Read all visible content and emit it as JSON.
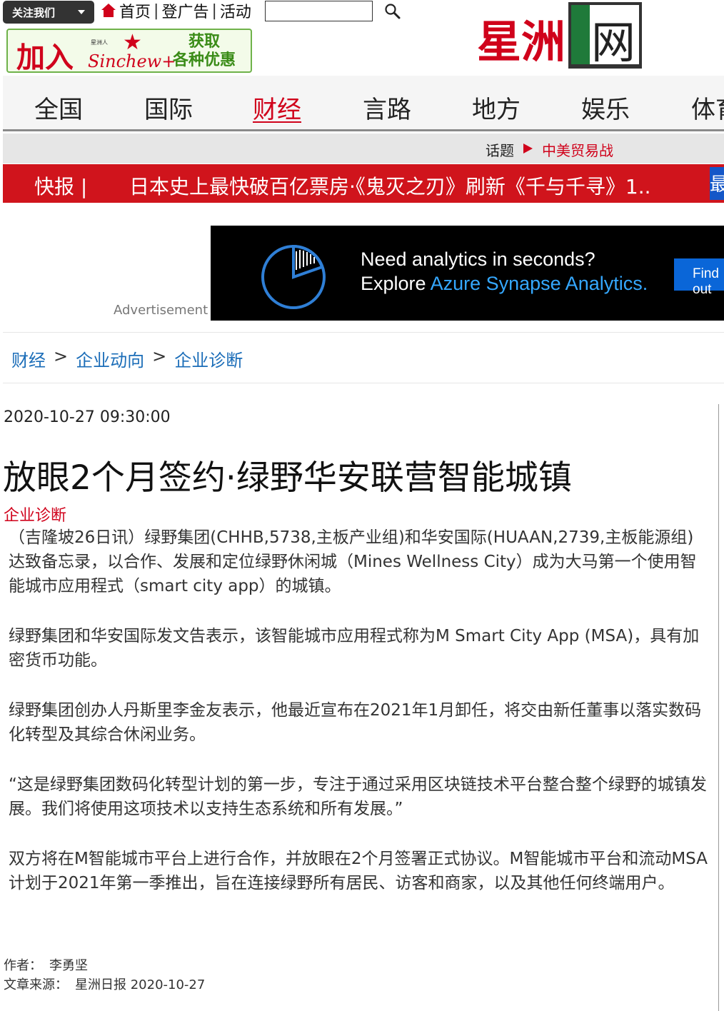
{
  "topbar": {
    "follow_label": "关注我们",
    "links": [
      "首页",
      "登广告",
      "活动"
    ],
    "separator": "|",
    "search_placeholder": ""
  },
  "join_banner": {
    "main": "加入",
    "sub": "星洲人",
    "brand": "Sinchew+",
    "offer_line1": "获取",
    "offer_line2": "各种优惠"
  },
  "logo": {
    "text": "星洲",
    "box_char": "网"
  },
  "nav": {
    "items": [
      "全国",
      "国际",
      "财经",
      "言路",
      "地方",
      "娱乐",
      "体育"
    ],
    "active": "财经"
  },
  "topic": {
    "label": "话题",
    "link": "中美贸易战"
  },
  "breaking": {
    "label": "快报 |",
    "headline": "日本史上最快破百亿票房·《鬼灭之刃》刷新《千与千寻》1...",
    "more": "最"
  },
  "ad": {
    "label": "Advertisement",
    "line1": "Need analytics in seconds?",
    "line2_prefix": "Explore ",
    "line2_highlight": "Azure Synapse Analytics.",
    "button": "Find out"
  },
  "breadcrumb": {
    "items": [
      "财经",
      "企业动向",
      "企业诊断"
    ],
    "separator": ">"
  },
  "article": {
    "datetime": "2020-10-27 09:30:00",
    "title": "放眼2个月签约·绿野华安联营智能城镇",
    "category": "企业诊断",
    "paragraphs": [
      "（吉隆坡26日讯）绿野集团(CHHB,5738,主板产业组)和华安国际(HUAAN,2739,主板能源组)达致备忘录，以合作、发展和定位绿野休闲城（Mines Wellness City）成为大马第一个使用智能城市应用程式（smart city app）的城镇。",
      "绿野集团和华安国际发文告表示，该智能城市应用程式称为M Smart City App (MSA)，具有加密货币功能。",
      "绿野集团创办人丹斯里李金友表示，他最近宣布在2021年1月卸任，将交由新任董事以落实数码化转型及其综合休闲业务。",
      "“这是绿野集团数码化转型计划的第一步，专注于通过采用区块链技术平台整合整个绿野的城镇发展。我们将使用这项技术以支持生态系统和所有发展。”",
      "双方将在M智能城市平台上进行合作，并放眼在2个月签署正式协议。M智能城市平台和流动MSA计划于2021年第一季推出，旨在连接绿野所有居民、访客和商家，以及其他任何终端用户。"
    ],
    "author_label": "作者：",
    "author": "李勇坚",
    "source_label": "文章来源：",
    "source": "星洲日报 2020-10-27"
  }
}
